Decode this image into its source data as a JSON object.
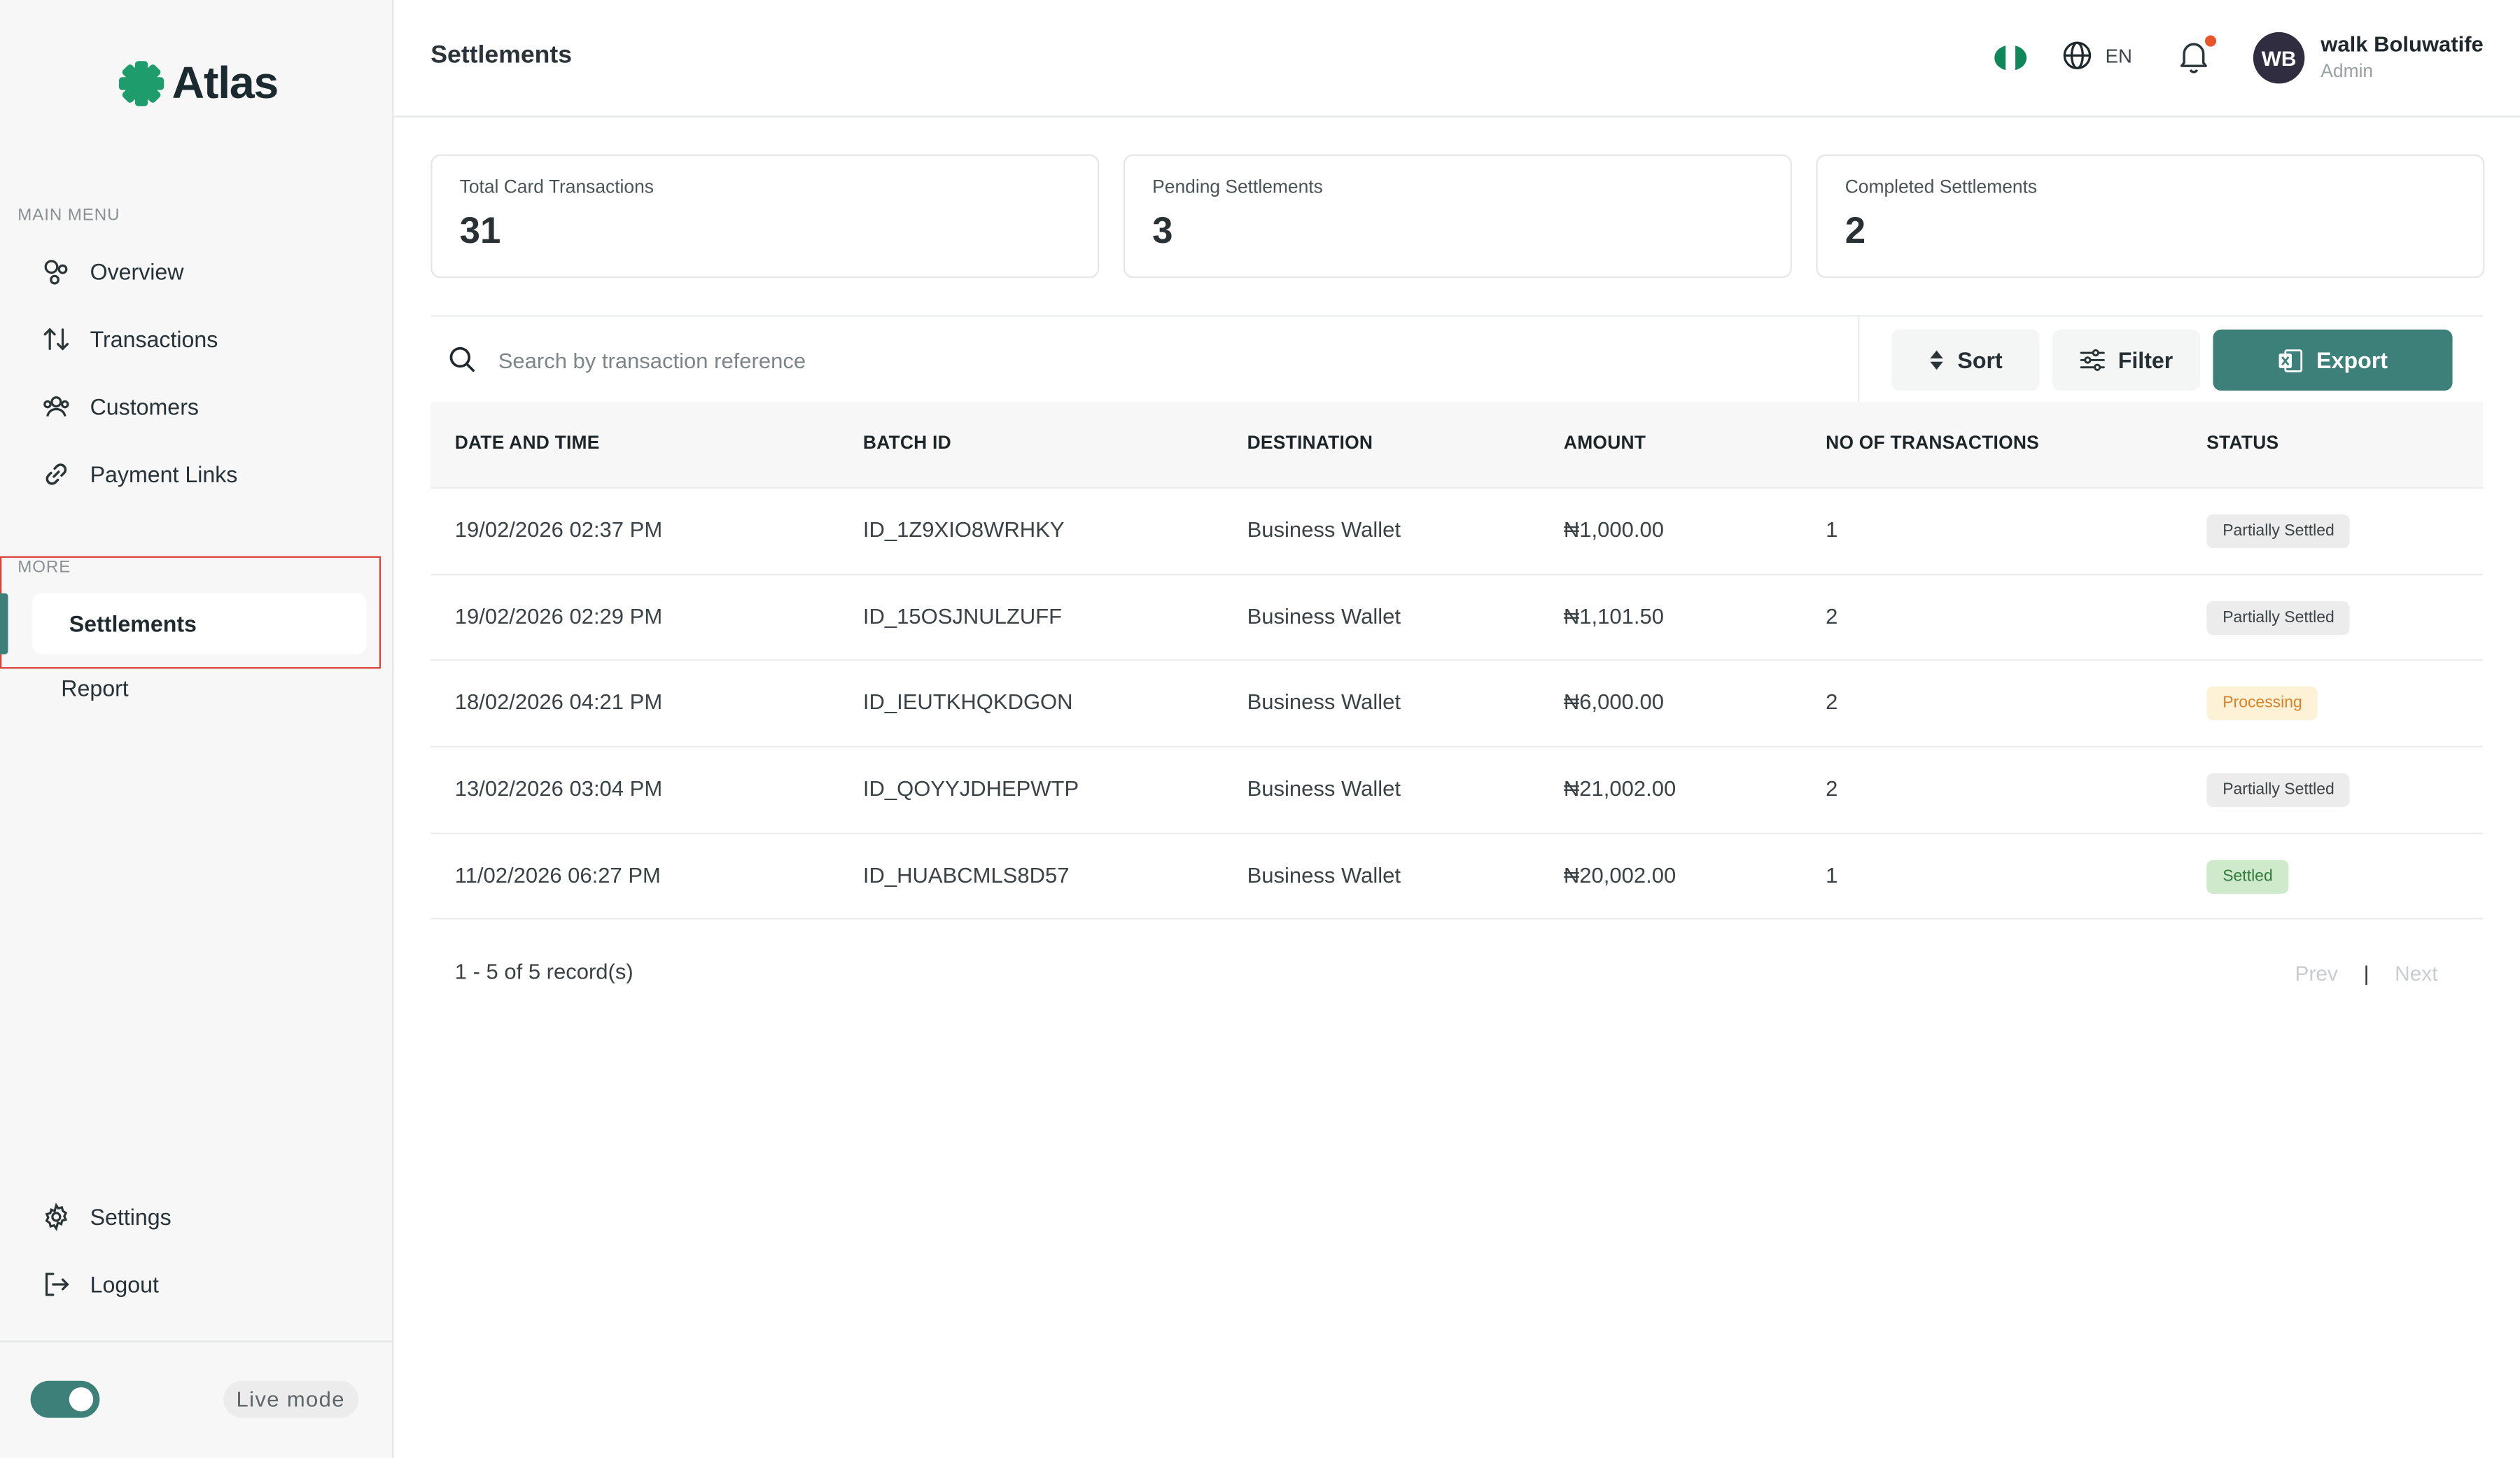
{
  "app": {
    "name": "Atlas"
  },
  "sidebar": {
    "main_menu_label": "MAIN MENU",
    "main_items": [
      {
        "label": "Overview",
        "icon": "overview-icon"
      },
      {
        "label": "Transactions",
        "icon": "arrows-icon"
      },
      {
        "label": "Customers",
        "icon": "users-icon"
      },
      {
        "label": "Payment Links",
        "icon": "link-icon"
      }
    ],
    "more_label": "MORE",
    "more_items": [
      {
        "label": "Settlements",
        "active": true
      },
      {
        "label": "Report"
      }
    ],
    "bottom_items": [
      {
        "label": "Settings",
        "icon": "gear-icon"
      },
      {
        "label": "Logout",
        "icon": "logout-icon"
      }
    ],
    "mode_label": "Live mode"
  },
  "header": {
    "title": "Settlements",
    "language": "EN",
    "user": {
      "initials": "WB",
      "name": "walk Boluwatife",
      "role": "Admin"
    }
  },
  "stats": [
    {
      "label": "Total Card Transactions",
      "value": "31"
    },
    {
      "label": "Pending Settlements",
      "value": "3"
    },
    {
      "label": "Completed Settlements",
      "value": "2"
    }
  ],
  "toolbar": {
    "search_placeholder": "Search by transaction reference",
    "sort_label": "Sort",
    "filter_label": "Filter",
    "export_label": "Export"
  },
  "table": {
    "columns": [
      "DATE AND TIME",
      "BATCH ID",
      "DESTINATION",
      "AMOUNT",
      "NO OF TRANSACTIONS",
      "STATUS"
    ],
    "rows": [
      {
        "date": "19/02/2026 02:37 PM",
        "batch": "ID_1Z9XIO8WRHKY",
        "destination": "Business Wallet",
        "amount": "₦1,000.00",
        "count": "1",
        "status": "Partially Settled"
      },
      {
        "date": "19/02/2026 02:29 PM",
        "batch": "ID_15OSJNULZUFF",
        "destination": "Business Wallet",
        "amount": "₦1,101.50",
        "count": "2",
        "status": "Partially Settled"
      },
      {
        "date": "18/02/2026 04:21 PM",
        "batch": "ID_IEUTKHQKDGON",
        "destination": "Business Wallet",
        "amount": "₦6,000.00",
        "count": "2",
        "status": "Processing"
      },
      {
        "date": "13/02/2026 03:04 PM",
        "batch": "ID_QOYYJDHEPWTP",
        "destination": "Business Wallet",
        "amount": "₦21,002.00",
        "count": "2",
        "status": "Partially Settled"
      },
      {
        "date": "11/02/2026 06:27 PM",
        "batch": "ID_HUABCMLS8D57",
        "destination": "Business Wallet",
        "amount": "₦20,002.00",
        "count": "1",
        "status": "Settled"
      }
    ]
  },
  "pagination": {
    "summary": "1 - 5 of 5 record(s)",
    "prev": "Prev",
    "separator": "|",
    "next": "Next"
  },
  "colors": {
    "accent": "#3d8079",
    "logo": "#1f9c6b",
    "badge_partial_bg": "#ececec",
    "badge_processing_bg": "#fdf1d6",
    "badge_processing_text": "#d9822b",
    "badge_settled_bg": "#cfeacb",
    "badge_settled_text": "#2f7a3c",
    "highlight": "#d9443a"
  }
}
